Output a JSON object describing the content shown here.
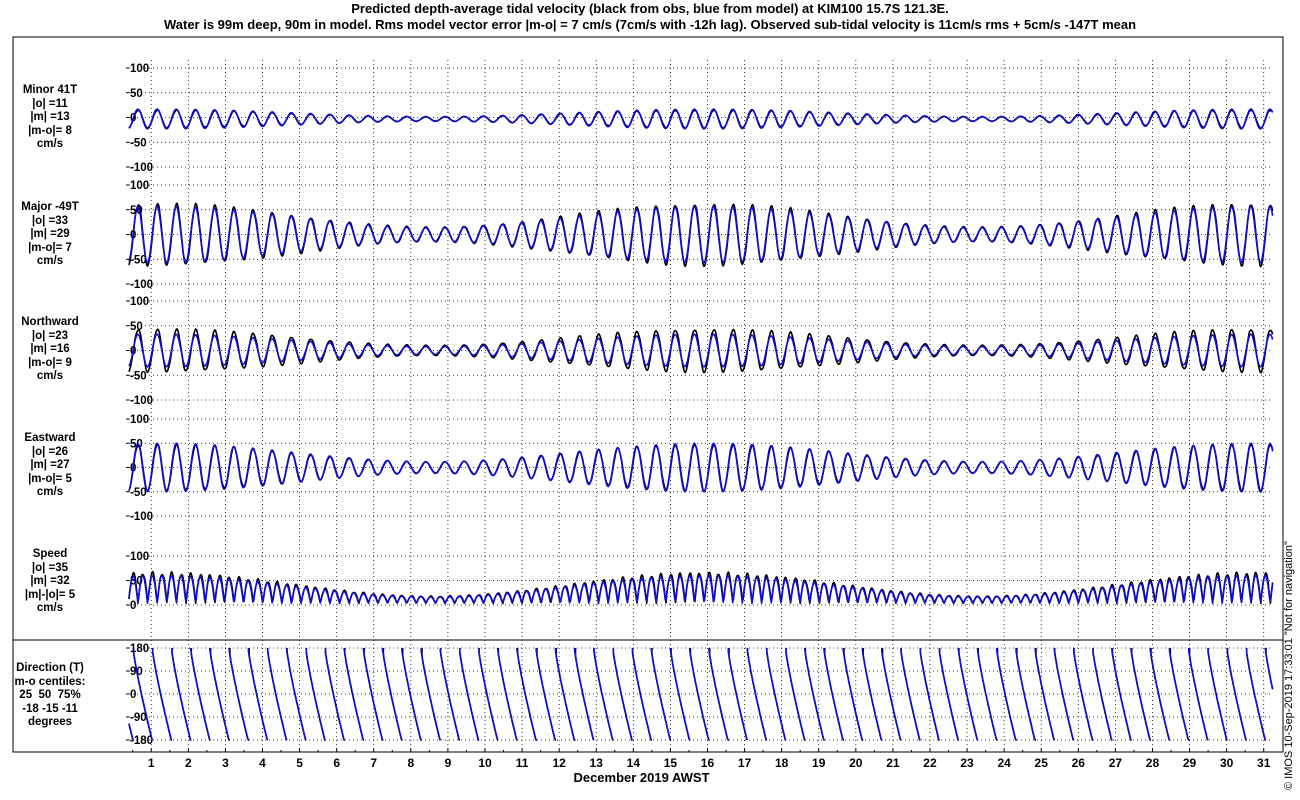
{
  "title": {
    "line1": "Predicted depth-average tidal velocity (black from obs, blue from model) at KIM100 15.7S 121.3E.",
    "line2": "Water is 99m deep, 90m in model. Rms model vector error |m-o| = 7 cm/s (7cm/s with -12h lag). Observed sub-tidal velocity is 11cm/s rms + 5cm/s -147T mean"
  },
  "footer_note": "© IMOS 10-Sep-2019 17:33:01  \"Not for navigation\"",
  "colors": {
    "obs": "#000000",
    "model": "#1010cc",
    "grid": "#000000"
  },
  "chart_data": {
    "type": "line",
    "xlabel": "December 2019 AWST",
    "x_ticks": [
      "1",
      "2",
      "3",
      "4",
      "5",
      "6",
      "7",
      "8",
      "9",
      "10",
      "11",
      "12",
      "13",
      "14",
      "15",
      "16",
      "17",
      "18",
      "19",
      "20",
      "21",
      "22",
      "23",
      "24",
      "25",
      "26",
      "27",
      "28",
      "29",
      "30",
      "31"
    ],
    "xlim_days": [
      0.4,
      31.25
    ],
    "series_names": [
      "obs",
      "model"
    ],
    "panels": [
      {
        "id": "minor",
        "label_lines": [
          "Minor 41T",
          "|o| =11",
          "|m| =13",
          "|m-o|= 8",
          "cm/s"
        ],
        "yticks": [
          "100",
          "50",
          "0",
          "-50",
          "-100"
        ],
        "ylim": [
          -100,
          100
        ],
        "obs_amplitude": 18,
        "model_amplitude": 20,
        "units": "cm/s"
      },
      {
        "id": "major",
        "label_lines": [
          "Major -49T",
          "|o| =33",
          "|m| =29",
          "|m-o|= 7",
          "cm/s"
        ],
        "yticks": [
          "100",
          "50",
          "0",
          "-50",
          "-100"
        ],
        "ylim": [
          -100,
          100
        ],
        "obs_amplitude": 62,
        "model_amplitude": 57,
        "units": "cm/s"
      },
      {
        "id": "northward",
        "label_lines": [
          "Northward",
          "|o| =23",
          "|m| =16",
          "|m-o|= 9",
          "cm/s"
        ],
        "yticks": [
          "100",
          "50",
          "0",
          "-50",
          "-100"
        ],
        "ylim": [
          -100,
          100
        ],
        "obs_amplitude": 43,
        "model_amplitude": 33,
        "units": "cm/s"
      },
      {
        "id": "eastward",
        "label_lines": [
          "Eastward",
          "|o| =26",
          "|m| =27",
          "|m-o|= 5",
          "cm/s"
        ],
        "yticks": [
          "100",
          "50",
          "0",
          "-50",
          "-100"
        ],
        "ylim": [
          -100,
          100
        ],
        "obs_amplitude": 48,
        "model_amplitude": 50,
        "units": "cm/s"
      },
      {
        "id": "speed",
        "label_lines": [
          "Speed",
          "|o| =35",
          "|m| =32",
          "|m|-|o|= 5",
          "cm/s"
        ],
        "yticks": [
          "100",
          "50",
          "0"
        ],
        "ylim": [
          0,
          100
        ],
        "obs_amplitude": 62,
        "model_amplitude": 57,
        "units": "cm/s"
      },
      {
        "id": "direction",
        "label_lines": [
          "Direction (T)",
          "m-o centiles:",
          "25  50  75%",
          "-18 -15 -11",
          "degrees"
        ],
        "yticks": [
          "180",
          "90",
          "0",
          "-90",
          "-180"
        ],
        "ylim": [
          -180,
          180
        ],
        "centiles": {
          "p25": -18,
          "p50": -15,
          "p75": -11
        },
        "units": "degrees"
      }
    ]
  }
}
